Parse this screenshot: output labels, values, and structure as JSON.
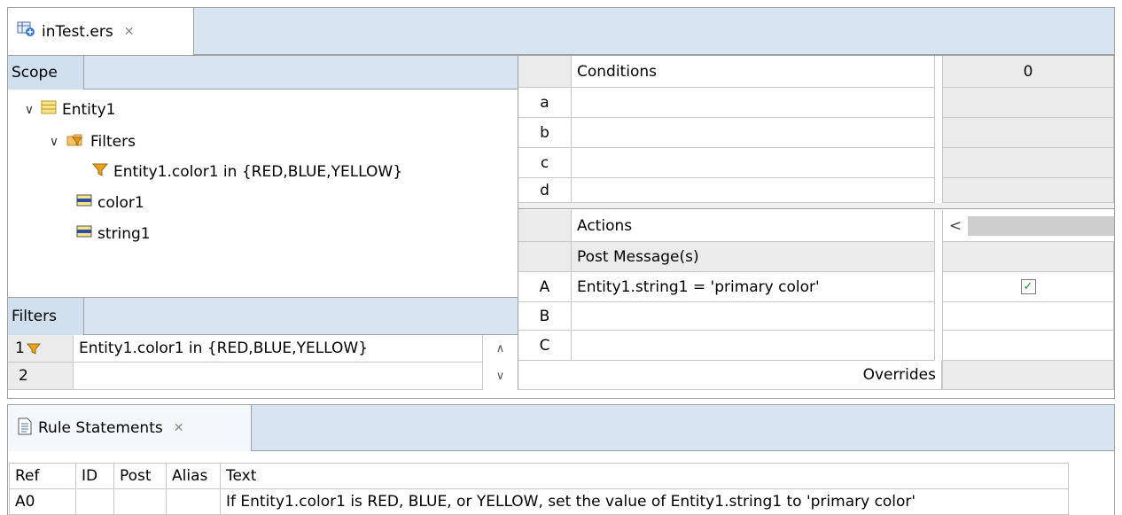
{
  "editor_tab": {
    "title": "inTest.ers",
    "close": "✕"
  },
  "scope": {
    "tab_label": "Scope",
    "entity": "Entity1",
    "filters_node": "Filters",
    "filter_item": "Entity1.color1 in {RED,BLUE,YELLOW}",
    "attributes": [
      "color1",
      "string1"
    ]
  },
  "filters_panel": {
    "tab_label": "Filters",
    "rows": [
      {
        "num": "1",
        "text": "Entity1.color1 in {RED,BLUE,YELLOW}"
      },
      {
        "num": "2",
        "text": ""
      }
    ]
  },
  "decision_table": {
    "conditions_label": "Conditions",
    "column_header": "0",
    "condition_rows": [
      "a",
      "b",
      "c",
      "d"
    ],
    "actions_label": "Actions",
    "post_messages_label": "Post Message(s)",
    "action_rows": [
      {
        "label": "A",
        "text": "Entity1.string1 = 'primary color'",
        "checked": true
      },
      {
        "label": "B",
        "text": "",
        "checked": false
      },
      {
        "label": "C",
        "text": "",
        "checked": false
      }
    ],
    "overrides_label": "Overrides",
    "scroll_left": "<"
  },
  "rule_statements": {
    "tab_title": "Rule Statements",
    "close": "✕",
    "headers": [
      "Ref",
      "ID",
      "Post",
      "Alias",
      "Text"
    ],
    "rows": [
      {
        "ref": "A0",
        "id": "",
        "post": "",
        "alias": "",
        "text": "If Entity1.color1 is RED, BLUE, or YELLOW, set the value of Entity1.string1 to 'primary color'"
      }
    ]
  },
  "colors": {
    "panel_header": "#d7e4f2",
    "grid_gray": "#ebebeb",
    "check_green": "#1e8a2e"
  }
}
